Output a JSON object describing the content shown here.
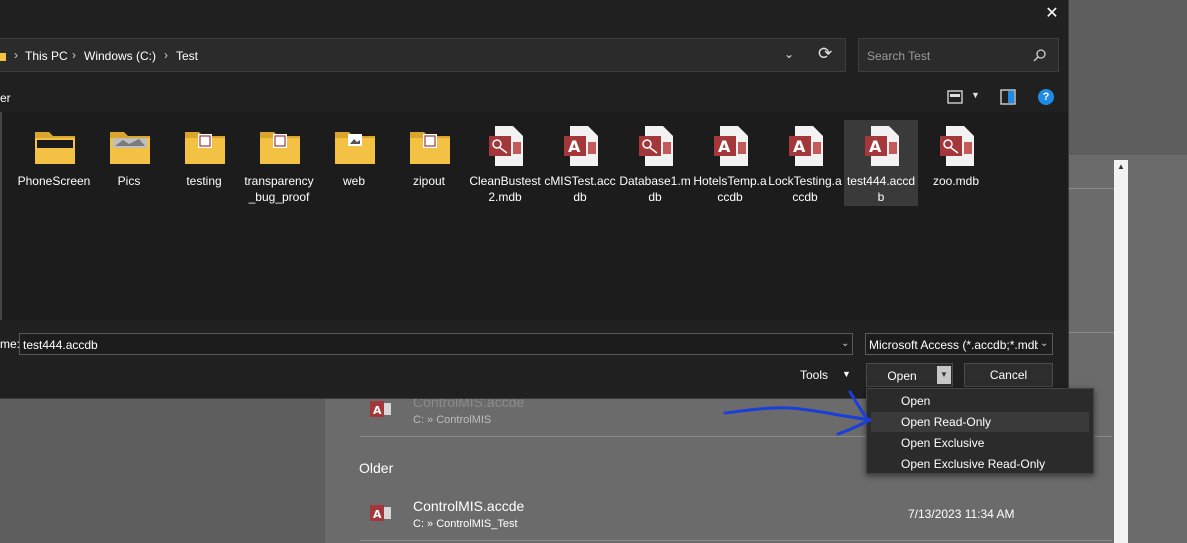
{
  "dialog": {
    "breadcrumb": [
      "This PC",
      "Windows (C:)",
      "Test"
    ],
    "search_placeholder": "Search Test",
    "toolbar_text": "er",
    "files": [
      {
        "label": "PhoneScreen",
        "type": "folder"
      },
      {
        "label": "Pics",
        "type": "folder"
      },
      {
        "label": "testing",
        "type": "folder"
      },
      {
        "label": "transparency_bug_proof",
        "type": "folder"
      },
      {
        "label": "web",
        "type": "folder"
      },
      {
        "label": "zipout",
        "type": "folder"
      },
      {
        "label": "CleanBustest2.mdb",
        "type": "mdb"
      },
      {
        "label": "cMISTest.accdb",
        "type": "accdb"
      },
      {
        "label": "Database1.mdb",
        "type": "mdb"
      },
      {
        "label": "HotelsTemp.accdb",
        "type": "accdb"
      },
      {
        "label": "LockTesting.accdb",
        "type": "accdb"
      },
      {
        "label": "test444.accdb",
        "type": "accdb"
      },
      {
        "label": "zoo.mdb",
        "type": "mdb"
      }
    ],
    "file_name_label": "me:",
    "file_name_value": "test444.accdb",
    "file_type_value": "Microsoft Access (*.accdb;*.mdb",
    "tools_label": "Tools",
    "open_label": "Open",
    "cancel_label": "Cancel",
    "open_menu": [
      "Open",
      "Open Read-Only",
      "Open Exclusive",
      "Open Exclusive Read-Only"
    ],
    "hovered_menu_item": "Open Read-Only"
  },
  "background": {
    "recent_top": {
      "name": "ControlMIS.accde",
      "path": "C: » ControlMIS"
    },
    "older_heading": "Older",
    "recent_older": {
      "name": "ControlMIS.accde",
      "path": "C: » ControlMIS_Test",
      "date": "7/13/2023 11:34 AM"
    }
  },
  "colors": {
    "access_red": "#a4373a",
    "folder_yellow": "#f3c245",
    "annotation_blue": "#1a3fd9",
    "help_blue": "#1e8ce6"
  },
  "icons": [
    "close-icon",
    "chevron-down-icon",
    "refresh-icon",
    "search-icon",
    "view-icon",
    "preview-pane-icon",
    "help-icon",
    "folder-icon",
    "access-file-icon",
    "mdb-file-icon"
  ]
}
